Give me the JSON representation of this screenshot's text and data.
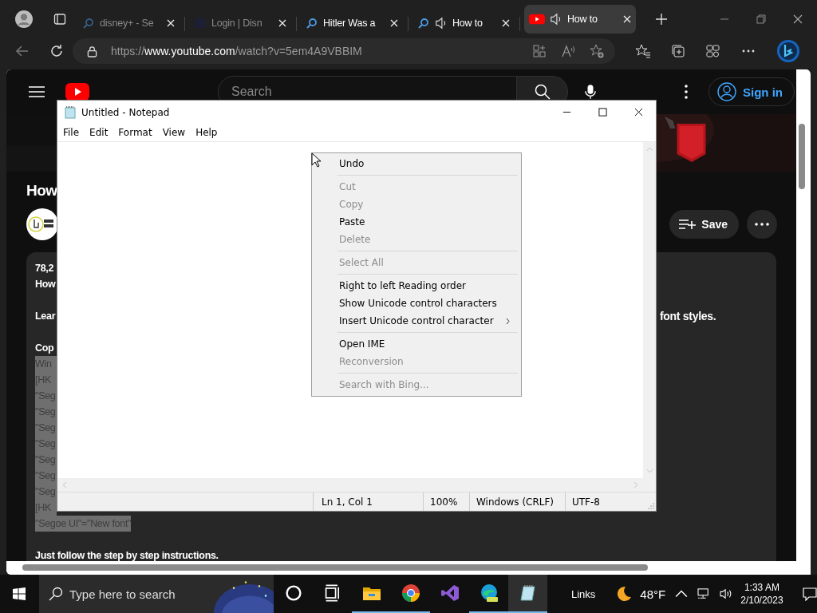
{
  "browser": {
    "tabs": [
      {
        "title": "disney+ - Se",
        "kind": "search",
        "audio": false,
        "sleeping": true,
        "selected": false
      },
      {
        "title": "Login | Disn",
        "kind": "square",
        "audio": false,
        "sleeping": true,
        "selected": false
      },
      {
        "title": "Hitler Was a",
        "kind": "search",
        "audio": false,
        "sleeping": false,
        "selected": false
      },
      {
        "title": "How to",
        "kind": "search",
        "audio": true,
        "sleeping": false,
        "selected": false
      },
      {
        "title": "How to",
        "kind": "youtube",
        "audio": true,
        "sleeping": false,
        "selected": true
      }
    ],
    "address": "https://**www.youtube.com**/watch?v=5em4A9VBBIM"
  },
  "youtube": {
    "search": {
      "placeholder": "Search"
    },
    "sign_in": "Sign in",
    "title": "How",
    "save": "Save",
    "description": {
      "stats": "78,2",
      "subtitle": "How",
      "text_left": "Lear",
      "text_right": "font styles.",
      "copy_label": "Cop",
      "code_lines": [
        "Win",
        "[HK",
        "\"Seg",
        "\"Seg",
        "\"Seg",
        "\"Seg",
        "\"Seg",
        "\"Seg",
        "\"Seg",
        "[HK",
        "\"Segoe UI\"=\"New font\""
      ],
      "footer": "Just follow the step by step instructions."
    }
  },
  "notepad": {
    "title": "Untitled - Notepad",
    "menu": [
      "File",
      "Edit",
      "Format",
      "View",
      "Help"
    ],
    "status": [
      "Ln 1, Col 1",
      "100%",
      "Windows (CRLF)",
      "UTF-8"
    ]
  },
  "context_menu": [
    {
      "kind": "item",
      "label": "Undo",
      "disabled": false
    },
    {
      "kind": "separator"
    },
    {
      "kind": "item",
      "label": "Cut",
      "disabled": true
    },
    {
      "kind": "item",
      "label": "Copy",
      "disabled": true
    },
    {
      "kind": "item",
      "label": "Paste",
      "disabled": false
    },
    {
      "kind": "item",
      "label": "Delete",
      "disabled": true
    },
    {
      "kind": "separator"
    },
    {
      "kind": "item",
      "label": "Select All",
      "disabled": true
    },
    {
      "kind": "separator"
    },
    {
      "kind": "item",
      "label": "Right to left Reading order",
      "disabled": false
    },
    {
      "kind": "item",
      "label": "Show Unicode control characters",
      "disabled": false
    },
    {
      "kind": "submenu",
      "label": "Insert Unicode control character",
      "disabled": false
    },
    {
      "kind": "separator"
    },
    {
      "kind": "item",
      "label": "Open IME",
      "disabled": false
    },
    {
      "kind": "item",
      "label": "Reconversion",
      "disabled": true
    },
    {
      "kind": "separator"
    },
    {
      "kind": "item",
      "label": "Search with Bing...",
      "disabled": true
    }
  ],
  "taskbar": {
    "search": {
      "placeholder": "Type here to search"
    },
    "apps": [
      {
        "kind": "cortana",
        "running": false,
        "selected": false
      },
      {
        "kind": "taskview",
        "running": false,
        "selected": false
      },
      {
        "kind": "explorer",
        "running": true,
        "selected": false
      },
      {
        "kind": "chrome",
        "running": true,
        "selected": false
      },
      {
        "kind": "studio",
        "running": false,
        "selected": false
      },
      {
        "kind": "edge",
        "running": true,
        "selected": false
      },
      {
        "kind": "notepad",
        "running": true,
        "selected": true
      }
    ],
    "links": "Links",
    "temperature": "48°F",
    "time": "1:33 AM",
    "date": "2/10/2023"
  }
}
